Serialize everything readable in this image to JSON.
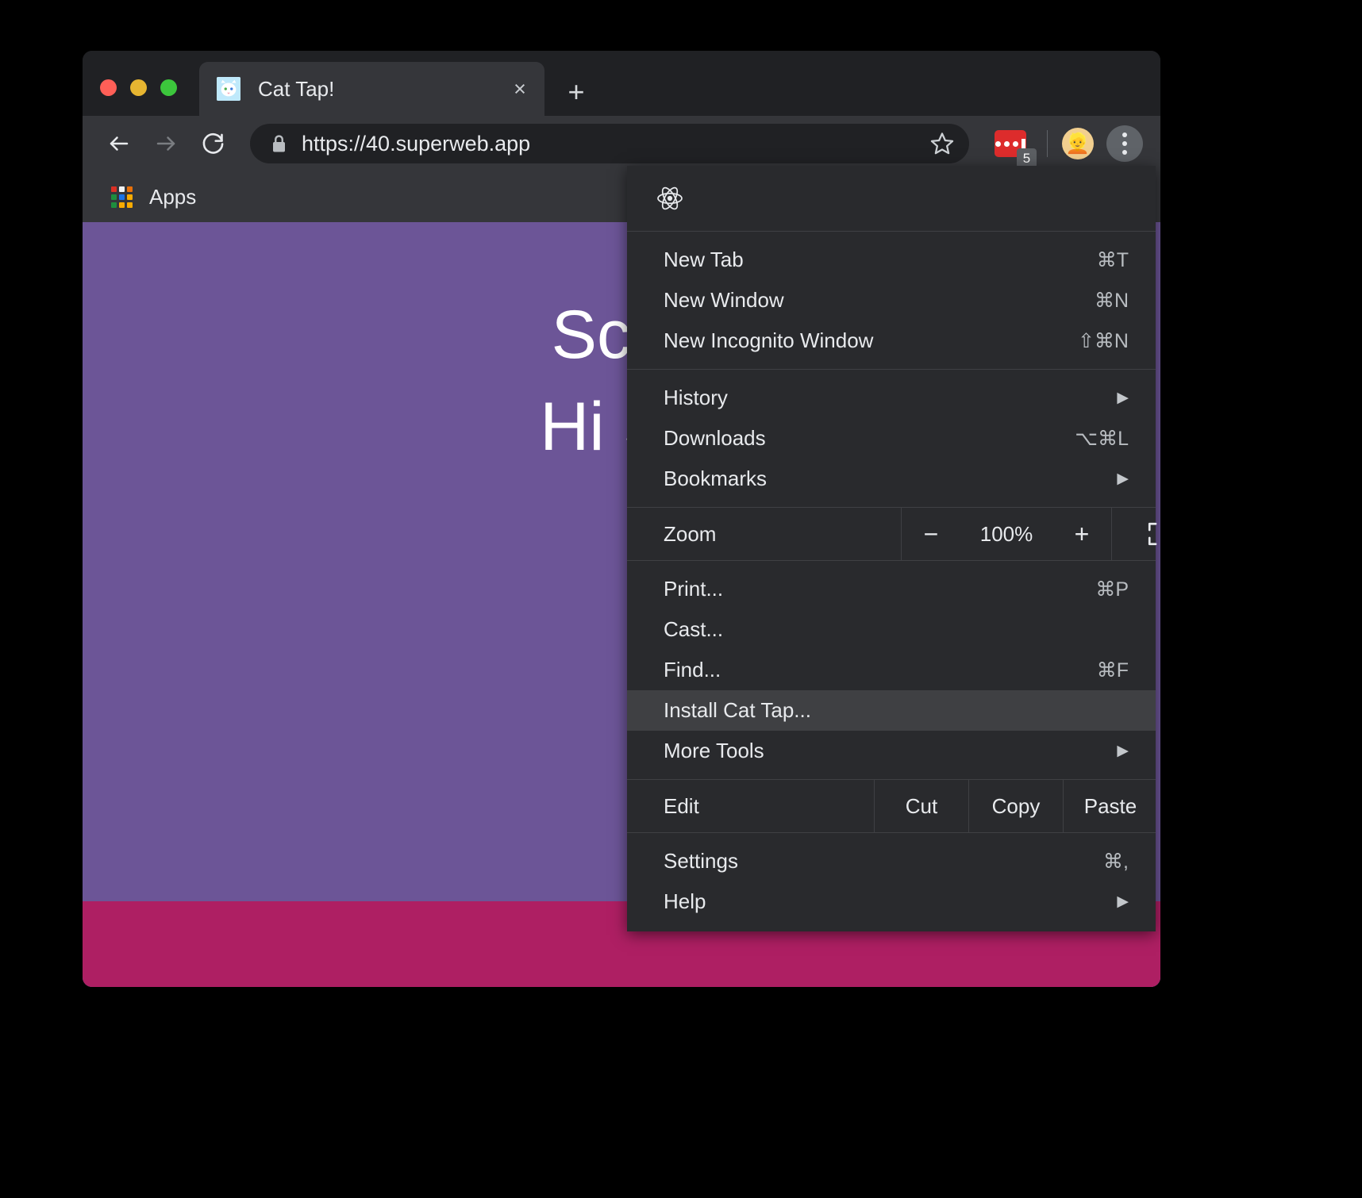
{
  "window": {
    "traffic_lights": [
      "close",
      "minimize",
      "maximize"
    ]
  },
  "tab": {
    "title": "Cat Tap!",
    "favicon": "cat-favicon",
    "close_label": "×",
    "new_tab_label": "+"
  },
  "toolbar": {
    "back_label": "back-arrow",
    "forward_label": "forward-arrow",
    "reload_label": "reload-arrow",
    "url": "https://40.superweb.app",
    "lock_label": "lock-icon",
    "star_label": "bookmark-star",
    "extension_badge": "5",
    "avatar_label": "👱",
    "menu_label": "three-dot-menu"
  },
  "bookmarks_bar": {
    "apps_label": "Apps",
    "apps_colors": [
      "#d93025",
      "#f1f3f4",
      "#e8710a",
      "#1e8e3e",
      "#1a73e8",
      "#f9ab00",
      "#1e8e3e",
      "#f9ab00",
      "#f9ab00"
    ]
  },
  "page": {
    "background_color": "#6c5597",
    "ground_color": "#ae1f63",
    "score_line": "Scor",
    "hiscore_line": "Hi Sc",
    "cat_colors": {
      "body": "#fdfdfd",
      "ear": "#f6cfd6",
      "eye": "#6cbd45",
      "nose": "#1a1a1a"
    }
  },
  "menu": {
    "header_icon": "react-atom-icon",
    "groups": [
      {
        "items": [
          {
            "label": "New Tab",
            "shortcut": "⌘T",
            "arrow": ""
          },
          {
            "label": "New Window",
            "shortcut": "⌘N",
            "arrow": ""
          },
          {
            "label": "New Incognito Window",
            "shortcut": "⇧⌘N",
            "arrow": ""
          }
        ]
      },
      {
        "items": [
          {
            "label": "History",
            "shortcut": "",
            "arrow": "▶"
          },
          {
            "label": "Downloads",
            "shortcut": "⌥⌘L",
            "arrow": ""
          },
          {
            "label": "Bookmarks",
            "shortcut": "",
            "arrow": "▶"
          }
        ]
      }
    ],
    "zoom_row": {
      "label": "Zoom",
      "minus": "−",
      "level": "100%",
      "plus": "+",
      "fullscreen": "fullscreen-icon"
    },
    "group_print": {
      "items": [
        {
          "label": "Print...",
          "shortcut": "⌘P",
          "arrow": ""
        },
        {
          "label": "Cast...",
          "shortcut": "",
          "arrow": ""
        },
        {
          "label": "Find...",
          "shortcut": "⌘F",
          "arrow": ""
        },
        {
          "label": "Install Cat Tap...",
          "shortcut": "",
          "arrow": "",
          "highlighted": true
        },
        {
          "label": "More Tools",
          "shortcut": "",
          "arrow": "▶"
        }
      ]
    },
    "edit_row": {
      "label": "Edit",
      "cut": "Cut",
      "copy": "Copy",
      "paste": "Paste"
    },
    "group_settings": {
      "items": [
        {
          "label": "Settings",
          "shortcut": "⌘,",
          "arrow": ""
        },
        {
          "label": "Help",
          "shortcut": "",
          "arrow": "▶"
        }
      ]
    }
  }
}
